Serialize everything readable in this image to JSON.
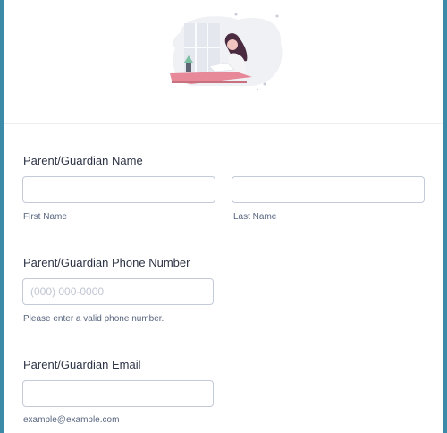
{
  "illustration": {
    "icon": "woman-writing-illustration",
    "accent": "#e8899a"
  },
  "guardian_name": {
    "title": "Parent/Guardian Name",
    "first_value": "",
    "first_sublabel": "First Name",
    "last_value": "",
    "last_sublabel": "Last Name"
  },
  "guardian_phone": {
    "title": "Parent/Guardian Phone Number",
    "value": "",
    "placeholder": "(000) 000-0000",
    "sublabel": "Please enter a valid phone number."
  },
  "guardian_email": {
    "title": "Parent/Guardian Email",
    "value": "",
    "sublabel": "example@example.com"
  }
}
